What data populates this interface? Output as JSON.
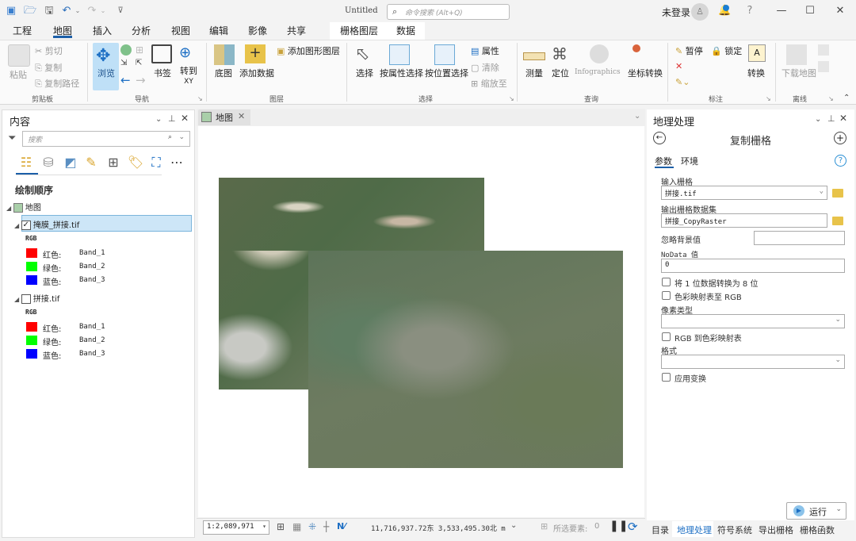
{
  "window": {
    "title": "Untitled",
    "search_placeholder": "命令搜索 (Alt+Q)",
    "login_label": "未登录",
    "help_label": "?",
    "minimize": "—",
    "maximize": "☐",
    "close": "✕"
  },
  "quick_access": [
    "new-project-icon",
    "open-icon",
    "save-icon",
    "undo-icon",
    "redo-icon",
    "customize-icon"
  ],
  "menu": {
    "tabs": [
      "工程",
      "地图",
      "插入",
      "分析",
      "视图",
      "编辑",
      "影像",
      "共享"
    ],
    "active": "地图",
    "context_tabs": [
      "栅格图层",
      "数据"
    ]
  },
  "ribbon": {
    "clipboard": {
      "label": "剪贴板",
      "paste": "粘贴",
      "cut": "剪切",
      "copy": "复制",
      "copy_path": "复制路径"
    },
    "navigate": {
      "label": "导航",
      "explore": "浏览",
      "bookmarks": "书签",
      "goto_xy": "转到\nXY",
      "goto_line1": "转到",
      "goto_line2": "XY"
    },
    "layer": {
      "label": "图层",
      "basemap": "底图",
      "add_data": "添加数据",
      "add_graphics_layer": "添加图形图层"
    },
    "selection": {
      "label": "选择",
      "select": "选择",
      "select_by_attr": "按属性选择",
      "select_by_loc": "按位置选择",
      "attributes": "属性",
      "clear": "清除",
      "zoom_to": "缩放至"
    },
    "inquiry": {
      "label": "查询",
      "measure": "测量",
      "locate": "定位",
      "infographics": "Infographics",
      "coord_convert": "坐标转换"
    },
    "labeling": {
      "label": "标注",
      "pause": "暂停",
      "lock": "锁定",
      "convert": "转换"
    },
    "offline": {
      "label": "离线",
      "download_map": "下载地图"
    }
  },
  "contents": {
    "title": "内容",
    "search_placeholder": "搜索",
    "section": "绘制顺序",
    "map_node": "地图",
    "layers": [
      {
        "name": "掩膜_拼接.tif",
        "checked": true,
        "selected": true,
        "renderer": "RGB",
        "bands": [
          {
            "channel": "红色:",
            "band": "Band_1",
            "color": "#ff0000"
          },
          {
            "channel": "绿色:",
            "band": "Band_2",
            "color": "#00ff00"
          },
          {
            "channel": "蓝色:",
            "band": "Band_3",
            "color": "#0000ff"
          }
        ]
      },
      {
        "name": "拼接.tif",
        "checked": false,
        "selected": false,
        "renderer": "RGB",
        "bands": [
          {
            "channel": "红色:",
            "band": "Band_1",
            "color": "#ff0000"
          },
          {
            "channel": "绿色:",
            "band": "Band_2",
            "color": "#00ff00"
          },
          {
            "channel": "蓝色:",
            "band": "Band_3",
            "color": "#0000ff"
          }
        ]
      }
    ]
  },
  "map": {
    "tab_label": "地图",
    "scale": "1:2,089,971",
    "coordinates": "11,716,937.72东 3,533,495.30北 m",
    "selected_features_label": "所选要素:",
    "selected_features_count": "0"
  },
  "geoprocessing": {
    "title": "地理处理",
    "tool_name": "复制栅格",
    "tabs": [
      "参数",
      "环境"
    ],
    "active_tab": "参数",
    "params": {
      "input_raster_label": "输入栅格",
      "input_raster_value": "拼接.tif",
      "output_label": "输出栅格数据集",
      "output_value": "拼接_CopyRaster",
      "ignore_bg_label": "忽略背景值",
      "ignore_bg_value": "",
      "nodata_label": "NoData 值",
      "nodata_value": "0",
      "convert_1bit_label": "将 1 位数据转换为 8 位",
      "colormap_rgb_label": "色彩映射表至 RGB",
      "pixel_type_label": "像素类型",
      "pixel_type_value": "",
      "rgb_colormap_label": "RGB 到色彩映射表",
      "format_label": "格式",
      "format_value": "",
      "apply_transform_label": "应用变换"
    },
    "run_label": "运行"
  },
  "bottom_tabs": [
    "目录",
    "地理处理",
    "符号系统",
    "导出栅格",
    "栅格函数"
  ],
  "bottom_active": "地理处理"
}
